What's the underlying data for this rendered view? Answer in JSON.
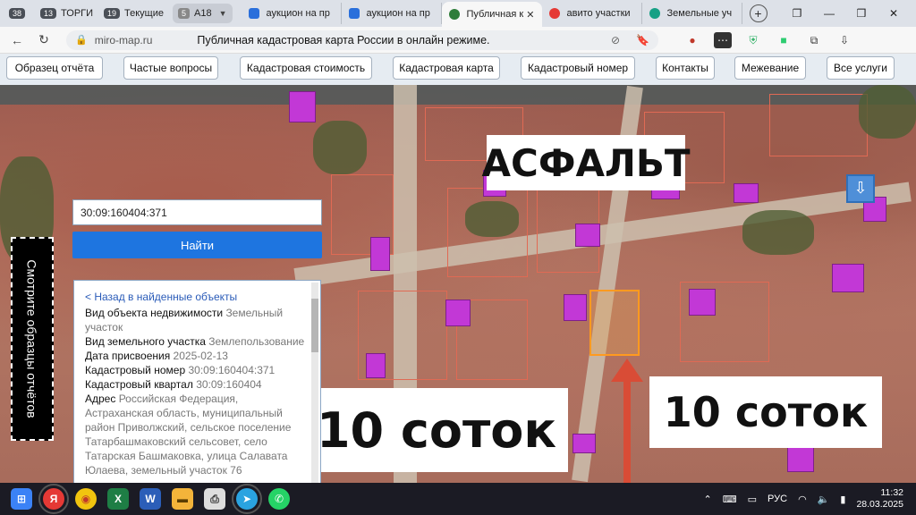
{
  "browser": {
    "tabs_count_label": "38",
    "tab_group_torgi": {
      "count": "13",
      "label": "ТОРГИ"
    },
    "tab_group_current": {
      "count": "19",
      "label": "Текущие"
    },
    "tab_group_a18": {
      "count": "5",
      "label": "А18"
    },
    "tabs": [
      {
        "label": "аукцион на пр",
        "color": "#2a6fdb"
      },
      {
        "label": "аукцион на пр",
        "color": "#2a6fdb"
      },
      {
        "label": "Публичная к",
        "color": "#2f7d3a",
        "active": true
      },
      {
        "label": "авито участки",
        "color": "#e53935"
      },
      {
        "label": "Земельные уч",
        "color": "#16a085"
      }
    ],
    "url_host": "miro-map.ru",
    "page_title": "Публичная кадастровая карта России в онлайн режиме."
  },
  "site_nav": {
    "items": [
      "Образец отчёта",
      "Частые вопросы",
      "Кадастровая стоимость",
      "Кадастровая карта",
      "Кадастровый номер",
      "Контакты",
      "Межевание",
      "Все услуги"
    ]
  },
  "search": {
    "value": "30:09:160404:371",
    "button_label": "Найти"
  },
  "info": {
    "back_link": "< Назад в найденные объекты",
    "rows": [
      {
        "key": "Вид объекта недвижимости",
        "value": "Земельный участок"
      },
      {
        "key": "Вид земельного участка",
        "value": "Землепользование"
      },
      {
        "key": "Дата присвоения",
        "value": "2025-02-13"
      },
      {
        "key": "Кадастровый номер",
        "value": "30:09:160404:371"
      },
      {
        "key": "Кадастровый квартал",
        "value": "30:09:160404"
      },
      {
        "key": "Адрес",
        "value": "Российская Федерация, Астраханская область, муниципальный район Приволжский, сельское поселение Татарбашмаковский сельсовет, село Татарская Башмаковка, улица Салавата Юлаева, земельный участок 76"
      }
    ]
  },
  "overlays": {
    "asphalt": "АСФАЛЬТ",
    "area_left": "10 соток",
    "area_right": "10 соток",
    "vertical_banner": "Смотрите образцы отчётов"
  },
  "taskbar": {
    "lang": "РУС",
    "time": "11:32",
    "date": "28.03.2025"
  }
}
